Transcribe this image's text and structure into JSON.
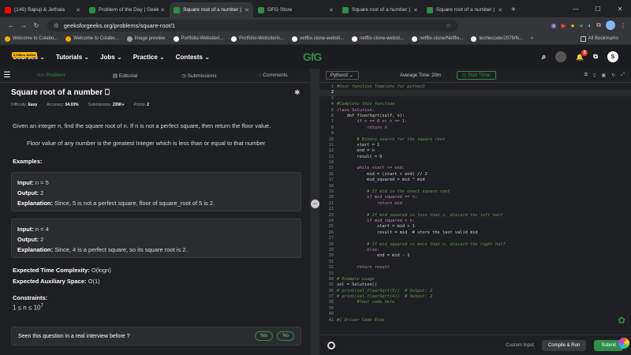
{
  "browser": {
    "tabs": [
      {
        "label": "(146) Bapuji & Jethala",
        "color": "#ff0000"
      },
      {
        "label": "Problem of the Day | Geek",
        "color": "#2f8d46"
      },
      {
        "label": "Square root of a number |",
        "color": "#2f8d46",
        "active": true
      },
      {
        "label": "GFG Store",
        "color": "#2f8d46"
      },
      {
        "label": "Square root of a number |",
        "color": "#2f8d46"
      },
      {
        "label": "Square root of a number |",
        "color": "#2f8d46"
      }
    ],
    "url": "geeksforgeeks.org/problems/square-root/1",
    "bookmarks": [
      "Welcome to Colabo...",
      "Welcome to Colabo...",
      "Image preview",
      "Portfolio-Website/i...",
      "Portfolio-Website/in...",
      "netflix-clone-websit...",
      "netflix-clone-websit...",
      "netflix-clone/Netflix...",
      "techiecoder2079/N..."
    ],
    "all_bookmarks": "All Bookmarks"
  },
  "gfg": {
    "offer": "3 Offers Active",
    "menus": [
      "Courses",
      "Tutorials",
      "Jobs",
      "Practice",
      "Contests"
    ],
    "logo": "GfG",
    "notif_count": "5",
    "avatar": "S"
  },
  "problem": {
    "tabs": [
      "Problem",
      "Editorial",
      "Submissions",
      "Comments"
    ],
    "title": "Square root of a number",
    "meta": {
      "difficulty_label": "Difficulty:",
      "difficulty": "Easy",
      "accuracy_label": "Accuracy:",
      "accuracy": "54.03%",
      "submissions_label": "Submissions:",
      "submissions": "235K+",
      "points_label": "Points:",
      "points": "2"
    },
    "description": "Given an integer n, find the square root of n. If n is not a perfect square, then return the floor value.",
    "floor_note": "Floor value of any number is the greatest Integer which is less than or equal to that number",
    "examples_heading": "Examples:",
    "examples": [
      {
        "input": "n = 5",
        "output": "2",
        "explanation": "Since, 5 is not a perfect square, floor of square_root of 5 is 2."
      },
      {
        "input": "n = 4",
        "output": "2",
        "explanation": "Since, 4 is a perfect square, so its square root is 2."
      }
    ],
    "input_label": "Input:",
    "output_label": "Output:",
    "explanation_label": "Explanation:",
    "time_label": "Expected Time Complexity:",
    "time": "O(logn)",
    "space_label": "Expected Auxiliary Space:",
    "space": "O(1)",
    "constraints_heading": "Constraints:",
    "constraint": "1 ≤ n ≤ 10",
    "constraint_exp": "7",
    "interview_q": "Seen this question in a real interview before ?",
    "yes": "Yes",
    "no": "No"
  },
  "editor": {
    "language": "Python3",
    "avg_time": "Average Time: 20m",
    "timer": "Start Timer",
    "custom_input": "Custom Input",
    "compile": "Compile & Run",
    "submit": "Submit",
    "lines": [
      {
        "n": "1",
        "t": "#User function Template for python3",
        "c": "cm"
      },
      {
        "n": "2",
        "t": "",
        "c": "txt"
      },
      {
        "n": "3",
        "t": "",
        "c": "txt"
      },
      {
        "n": "4",
        "t": "#Complete this function",
        "c": "cm"
      },
      {
        "n": "5",
        "t": "class Solution:",
        "c": "kw"
      },
      {
        "n": "6",
        "t": "    def floorSqrt(self, n):",
        "c": "fn"
      },
      {
        "n": "7",
        "t": "        if n == 0 or n == 1:",
        "c": "kw"
      },
      {
        "n": "8",
        "t": "            return n",
        "c": "kw"
      },
      {
        "n": "9",
        "t": "",
        "c": "txt"
      },
      {
        "n": "10",
        "t": "        # Binary search for the square root",
        "c": "cm"
      },
      {
        "n": "11",
        "t": "        start = 1",
        "c": "txt"
      },
      {
        "n": "12",
        "t": "        end = n",
        "c": "txt"
      },
      {
        "n": "13",
        "t": "        result = 0",
        "c": "txt"
      },
      {
        "n": "14",
        "t": "",
        "c": "txt"
      },
      {
        "n": "15",
        "t": "        while start <= end:",
        "c": "kw"
      },
      {
        "n": "16",
        "t": "            mid = (start + end) // 2",
        "c": "txt"
      },
      {
        "n": "17",
        "t": "            mid_squared = mid * mid",
        "c": "txt"
      },
      {
        "n": "18",
        "t": "",
        "c": "txt"
      },
      {
        "n": "19",
        "t": "            # If mid is the exact square root",
        "c": "cm"
      },
      {
        "n": "20",
        "t": "            if mid_squared == n:",
        "c": "kw"
      },
      {
        "n": "21",
        "t": "                return mid",
        "c": "kw"
      },
      {
        "n": "22",
        "t": "",
        "c": "txt"
      },
      {
        "n": "23",
        "t": "            # If mid_squared is less than n, discard the left half",
        "c": "cm"
      },
      {
        "n": "24",
        "t": "            if mid_squared < n:",
        "c": "kw"
      },
      {
        "n": "25",
        "t": "                start = mid + 1",
        "c": "txt"
      },
      {
        "n": "26",
        "t": "                result = mid  # store the last valid mid",
        "c": "txt"
      },
      {
        "n": "27",
        "t": "",
        "c": "txt"
      },
      {
        "n": "28",
        "t": "            # If mid_squared is more than n, discard the right half",
        "c": "cm"
      },
      {
        "n": "29",
        "t": "            else:",
        "c": "kw"
      },
      {
        "n": "30",
        "t": "                end = mid - 1",
        "c": "txt"
      },
      {
        "n": "31",
        "t": "",
        "c": "txt"
      },
      {
        "n": "32",
        "t": "        return result",
        "c": "kw"
      },
      {
        "n": "33",
        "t": "",
        "c": "txt"
      },
      {
        "n": "34",
        "t": "# Example usage",
        "c": "cm"
      },
      {
        "n": "35",
        "t": "sol = Solution()",
        "c": "txt"
      },
      {
        "n": "36",
        "t": "# print(sol.floorSqrt(5))  # Output: 2",
        "c": "cm"
      },
      {
        "n": "37",
        "t": "# print(sol.floorSqrt(4))  # Output: 2",
        "c": "cm"
      },
      {
        "n": "38",
        "t": "        #Your code here",
        "c": "cm"
      },
      {
        "n": "39",
        "t": "",
        "c": "txt"
      },
      {
        "n": "40",
        "t": "",
        "c": "txt"
      },
      {
        "n": "41",
        "t": "#{ Driver Code Ends",
        "c": "cm"
      }
    ]
  }
}
